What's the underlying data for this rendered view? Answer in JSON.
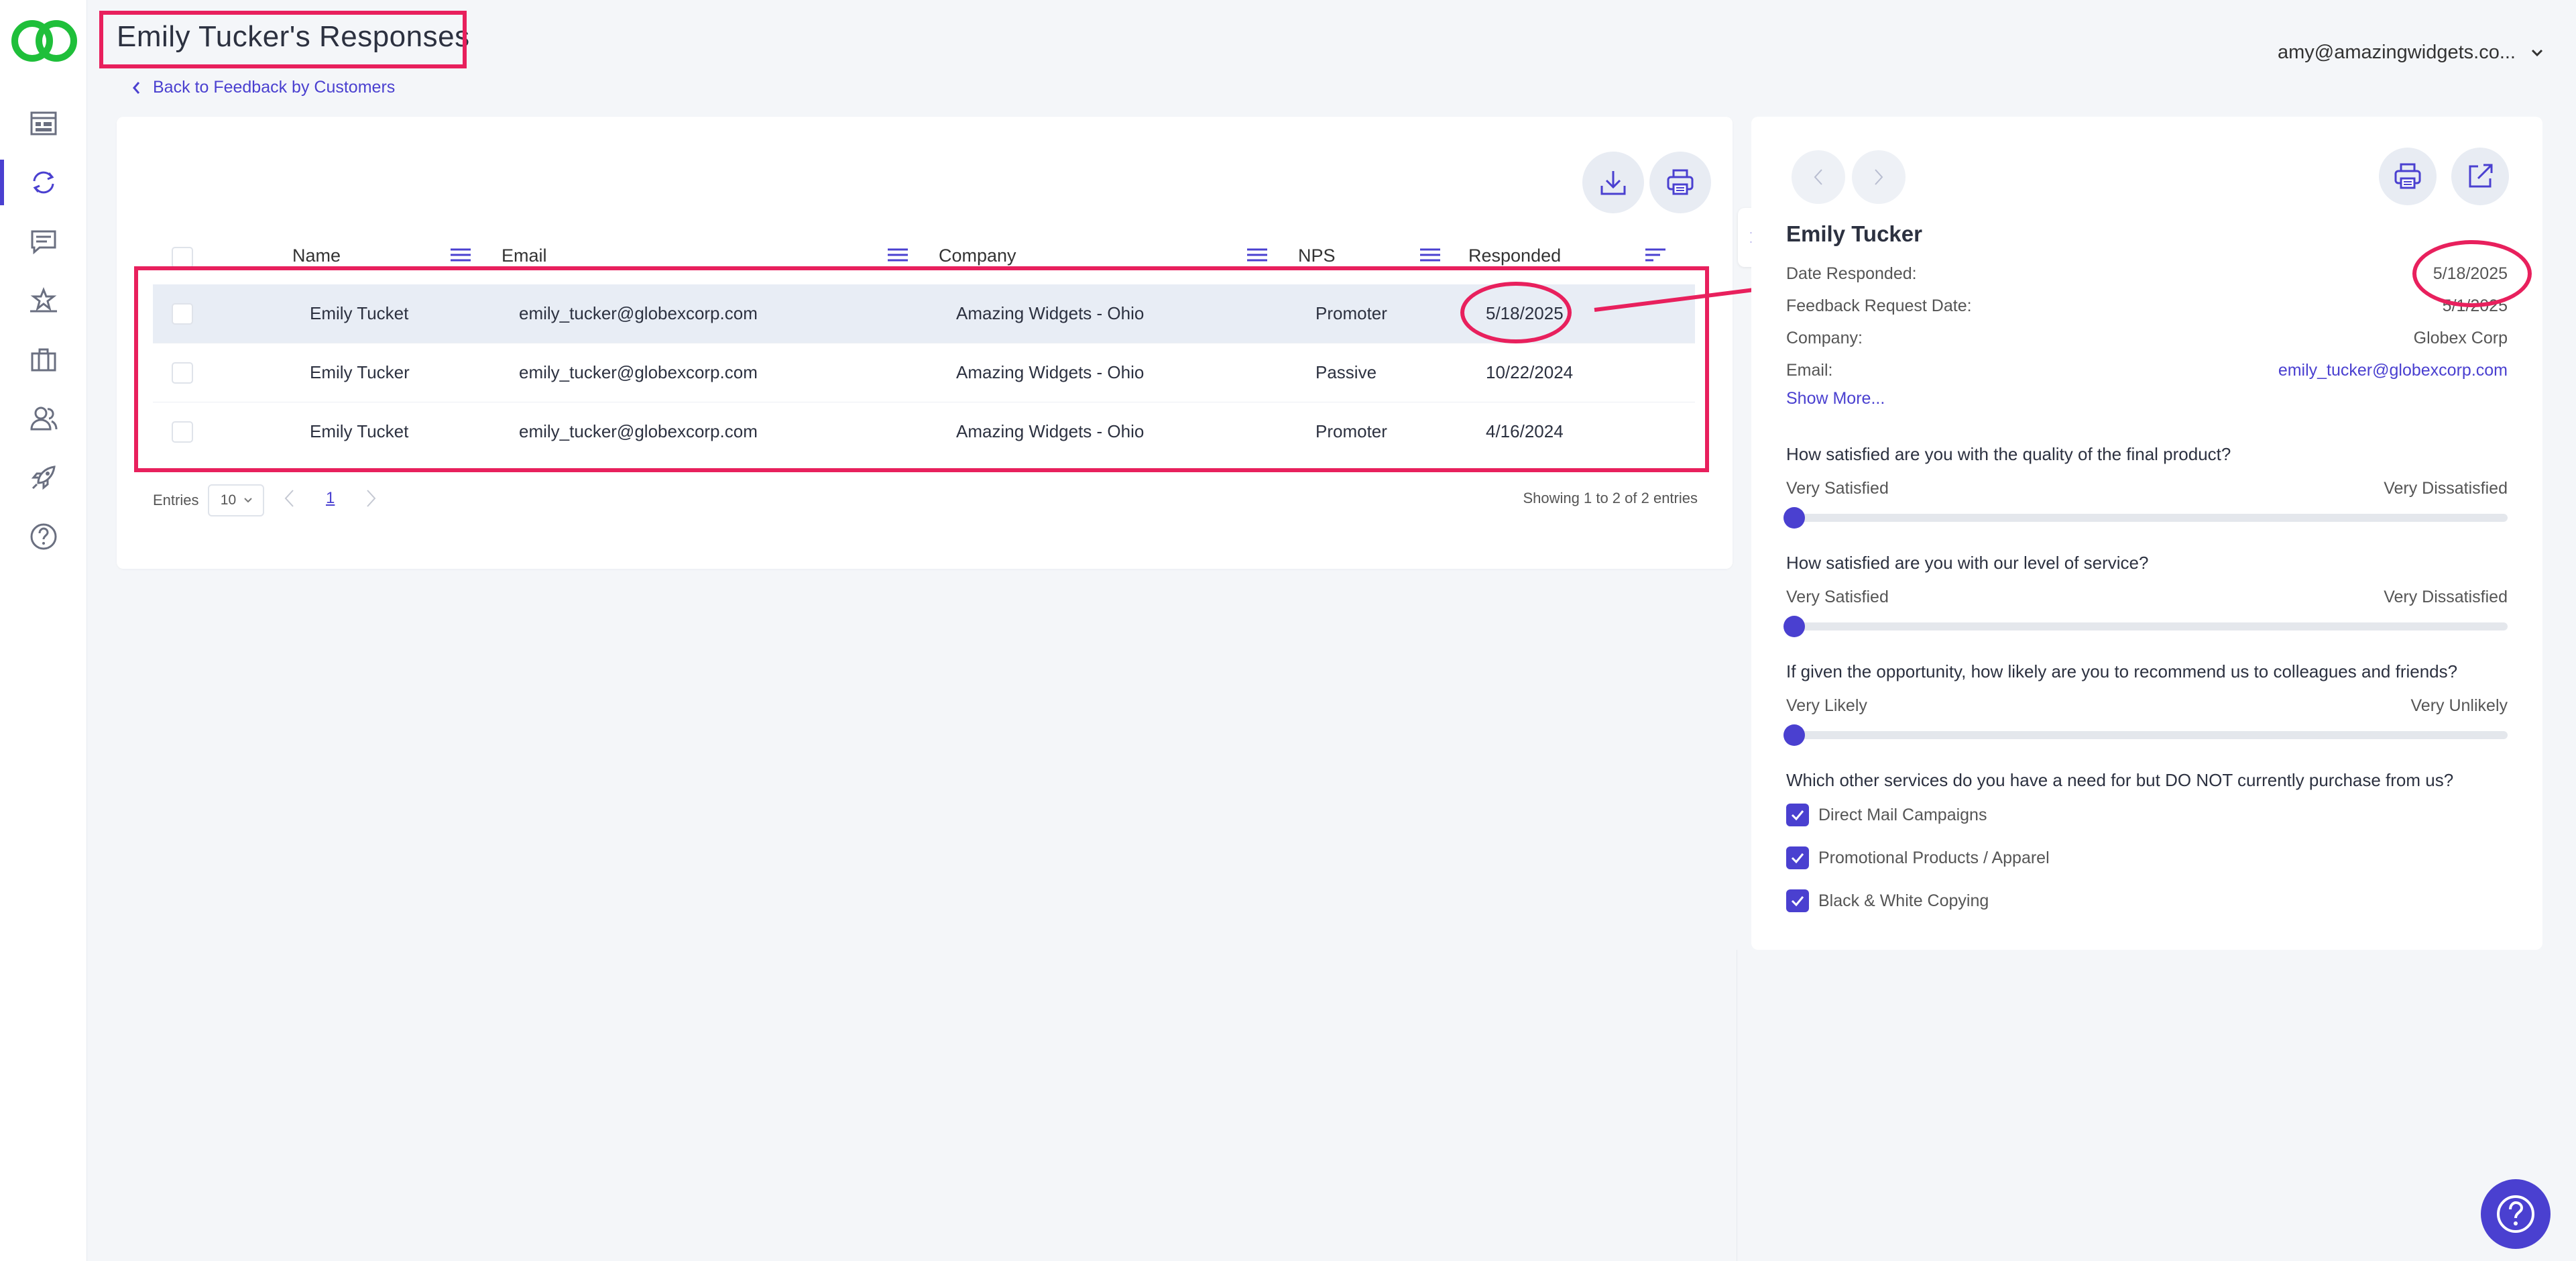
{
  "header": {
    "title": "Emily Tucker's Responses",
    "back_link": "Back to Feedback by Customers",
    "user_email": "amy@amazingwidgets.co..."
  },
  "sidebar": {
    "items": [
      {
        "name": "dashboard",
        "icon": "dashboard-icon"
      },
      {
        "name": "feedback",
        "icon": "sync-icon",
        "active": true
      },
      {
        "name": "messages",
        "icon": "message-icon"
      },
      {
        "name": "reviews",
        "icon": "stars-icon"
      },
      {
        "name": "campaigns",
        "icon": "briefcase-icon"
      },
      {
        "name": "customers",
        "icon": "users-icon"
      },
      {
        "name": "launch",
        "icon": "rocket-icon"
      },
      {
        "name": "help",
        "icon": "question-icon"
      }
    ]
  },
  "table": {
    "columns": [
      "Name",
      "Email",
      "Company",
      "NPS",
      "Responded"
    ],
    "rows": [
      {
        "name": "Emily Tucket",
        "email": "emily_tucker@globexcorp.com",
        "company": "Amazing Widgets - Ohio",
        "nps": "Promoter",
        "responded": "5/18/2025",
        "selected": true
      },
      {
        "name": "Emily Tucker",
        "email": "emily_tucker@globexcorp.com",
        "company": "Amazing Widgets - Ohio",
        "nps": "Passive",
        "responded": "10/22/2024"
      },
      {
        "name": "Emily Tucket",
        "email": "emily_tucker@globexcorp.com",
        "company": "Amazing Widgets - Ohio",
        "nps": "Promoter",
        "responded": "4/16/2024"
      }
    ],
    "entries_label": "Entries",
    "entries_value": "10",
    "page": "1",
    "showing": "Showing 1 to 2 of 2 entries"
  },
  "detail": {
    "name": "Emily Tucker",
    "fields": [
      {
        "label": "Date Responded:",
        "value": "5/18/2025"
      },
      {
        "label": "Feedback Request Date:",
        "value": "5/1/2025"
      },
      {
        "label": "Company:",
        "value": "Globex Corp"
      },
      {
        "label": "Email:",
        "value": "emily_tucker@globexcorp.com"
      }
    ],
    "show_more": "Show More...",
    "questions": [
      {
        "text": "How satisfied are you with the quality of the final product?",
        "low": "Very Satisfied",
        "high": "Very Dissatisfied",
        "level": 0
      },
      {
        "text": "How satisfied are you with our level of service?",
        "low": "Very Satisfied",
        "high": "Very Dissatisfied",
        "level": 0
      },
      {
        "text": "If given the opportunity, how likely are you to recommend us to colleagues and friends?",
        "low": "Very Likely",
        "high": "Very Unlikely",
        "level": 0
      }
    ],
    "services_question": "Which other services do you have a need for but DO NOT currently purchase from us?",
    "services": [
      "Direct Mail Campaigns",
      "Promotional Products / Apparel",
      "Black & White Copying"
    ]
  },
  "colors": {
    "accent": "#4a40d0",
    "highlight": "#e8205d",
    "logo": "#1fbf3a"
  }
}
